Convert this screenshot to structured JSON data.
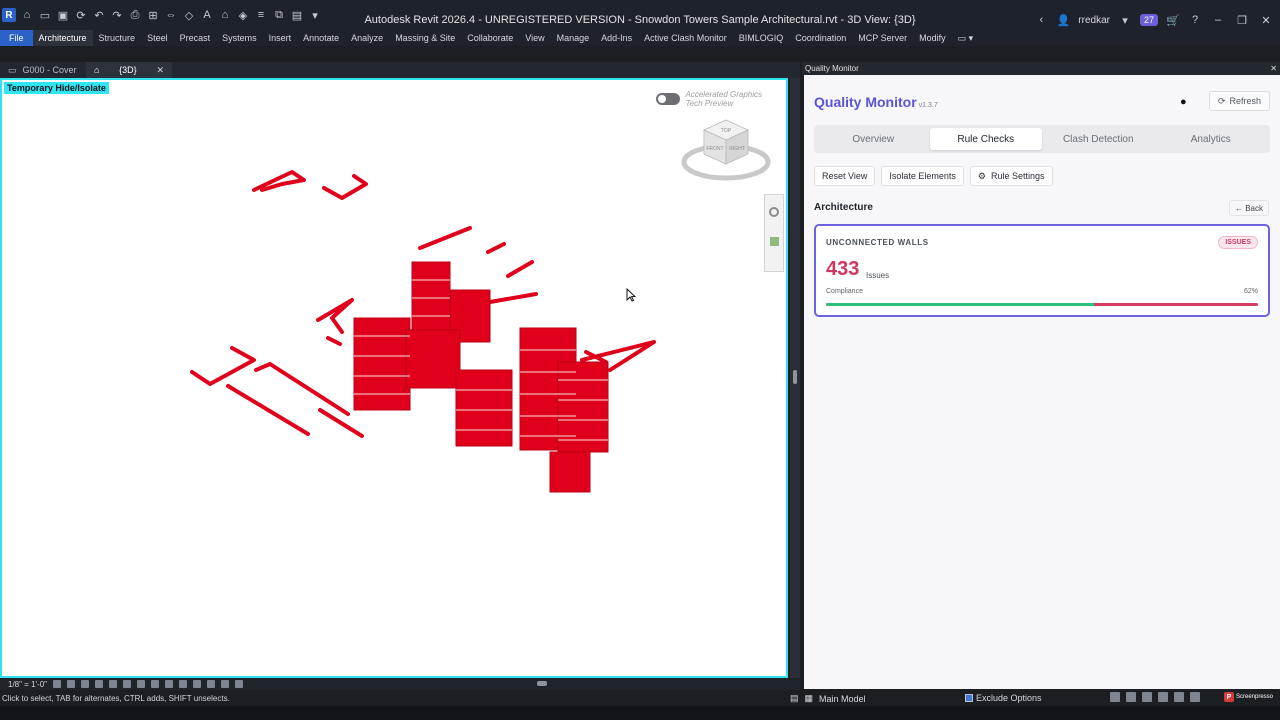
{
  "app": {
    "title": "Autodesk Revit 2026.4 - UNREGISTERED VERSION - Snowdon Towers Sample Architectural.rvt - 3D View: {3D}",
    "logo_letter": "R",
    "user": "rredkar",
    "notification_count": "27"
  },
  "ribbon": {
    "tabs": [
      "File",
      "Architecture",
      "Structure",
      "Steel",
      "Precast",
      "Systems",
      "Insert",
      "Annotate",
      "Analyze",
      "Massing & Site",
      "Collaborate",
      "View",
      "Manage",
      "Add-Ins",
      "Active Clash Monitor",
      "BIMLOGIQ",
      "Coordination",
      "MCP Server",
      "Modify"
    ],
    "active": "Architecture"
  },
  "view_tabs": [
    {
      "label": "G000 - Cover",
      "active": false
    },
    {
      "label": "{3D}",
      "active": true
    }
  ],
  "viewport": {
    "hide_isolate": "Temporary Hide/Isolate",
    "accel_line1": "Accelerated Graphics",
    "accel_line2": "Tech Preview",
    "cube_top": "TOP",
    "cube_front": "FRONT",
    "cube_right": "RIGHT",
    "model_color": "#e0001b",
    "border_color": "#30e3f0"
  },
  "view_bar": {
    "scale": "1/8\" = 1'-0\""
  },
  "status": {
    "hint": "Click to select, TAB for alternates, CTRL adds, SHIFT unselects.",
    "model": "Main Model",
    "exclude_options": "Exclude Options"
  },
  "panel": {
    "header": "Quality Monitor",
    "title": "Quality Monitor",
    "version": "v1.3.7",
    "refresh": "Refresh",
    "tabs": [
      {
        "label": "Overview",
        "active": false
      },
      {
        "label": "Rule Checks",
        "active": true
      },
      {
        "label": "Clash Detection",
        "active": false
      },
      {
        "label": "Analytics",
        "active": false
      }
    ],
    "actions": {
      "reset_view": "Reset View",
      "isolate": "Isolate Elements",
      "rule_settings": "Rule Settings"
    },
    "section": "Architecture",
    "back": "← Back",
    "card": {
      "label": "UNCONNECTED WALLS",
      "badge": "ISSUES",
      "count": "433",
      "count_label": "Issues",
      "compliance_label": "Compliance",
      "compliance_pct": "62%",
      "compliance_value": 62
    },
    "accent_color": "#5b55d6"
  },
  "watermark": "Screenpresso"
}
